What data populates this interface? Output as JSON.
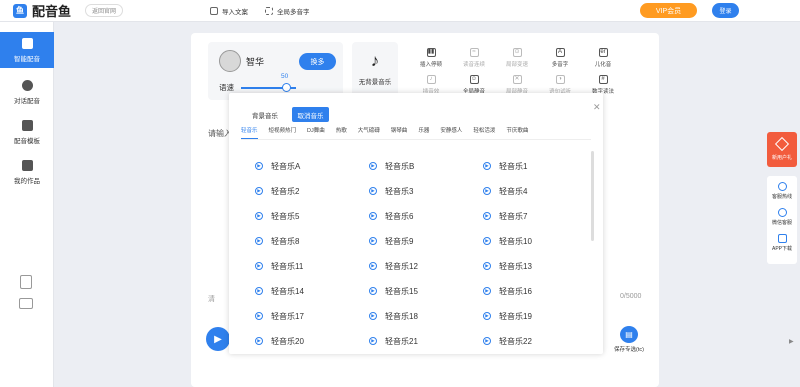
{
  "app": {
    "name": "配音鱼",
    "logo_glyph": "鱼",
    "back_label": "返回官网"
  },
  "topbar": {
    "import_label": "导入文案",
    "multitone_label": "全局多音字",
    "vip_label": "VIP会员",
    "login_label": "登录"
  },
  "colors": {
    "accent": "#2f80ed",
    "vip": "#ff9b21",
    "promo": "#f25c3d"
  },
  "sidebar": {
    "items": [
      {
        "label": "智能配音",
        "icon": "mic-icon",
        "active": true
      },
      {
        "label": "对话配音",
        "icon": "users-icon",
        "active": false
      },
      {
        "label": "配音模板",
        "icon": "template-icon",
        "active": false
      },
      {
        "label": "我的作品",
        "icon": "folder-icon",
        "active": false
      }
    ]
  },
  "voice": {
    "name": "智华",
    "change_label": "换多",
    "speed_label": "语速",
    "speed_value": "50"
  },
  "background": {
    "label": "无背景音乐",
    "icon": "music-note-icon"
  },
  "tools": [
    {
      "label": "插入停顿",
      "glyph": "▮▮"
    },
    {
      "label": "读音连续",
      "glyph": "≈"
    },
    {
      "label": "局部变速",
      "glyph": "⊙"
    },
    {
      "label": "多音字",
      "glyph": "A"
    },
    {
      "label": "儿化音",
      "glyph": "ér"
    },
    {
      "label": "插音效",
      "glyph": "♪"
    },
    {
      "label": "全局静音",
      "glyph": "☺"
    },
    {
      "label": "局部静音",
      "glyph": "✕"
    },
    {
      "label": "语句试听",
      "glyph": "◑"
    },
    {
      "label": "数字读法",
      "glyph": "#"
    }
  ],
  "editor": {
    "hint": "请输入",
    "clear_label": "清",
    "count": "0/5000",
    "save_label": "保存专选(tc)"
  },
  "modal": {
    "tab_bg": "背景音乐",
    "tab_cancel": "取消音乐",
    "categories": [
      "轻音乐",
      "短视频热门",
      "DJ舞曲",
      "热歌",
      "大气磅礴",
      "钢琴曲",
      "乐器",
      "安静感人",
      "轻松活泼",
      "节庆歌曲"
    ],
    "songs": [
      "轻音乐A",
      "轻音乐B",
      "轻音乐1",
      "轻音乐2",
      "轻音乐3",
      "轻音乐4",
      "轻音乐5",
      "轻音乐6",
      "轻音乐7",
      "轻音乐8",
      "轻音乐9",
      "轻音乐10",
      "轻音乐11",
      "轻音乐12",
      "轻音乐13",
      "轻音乐14",
      "轻音乐15",
      "轻音乐16",
      "轻音乐17",
      "轻音乐18",
      "轻音乐19",
      "轻音乐20",
      "轻音乐21",
      "轻音乐22"
    ]
  },
  "right_panel": {
    "promo_label": "新用户礼",
    "items": [
      "客服热线",
      "微信客服",
      "APP下载"
    ]
  }
}
